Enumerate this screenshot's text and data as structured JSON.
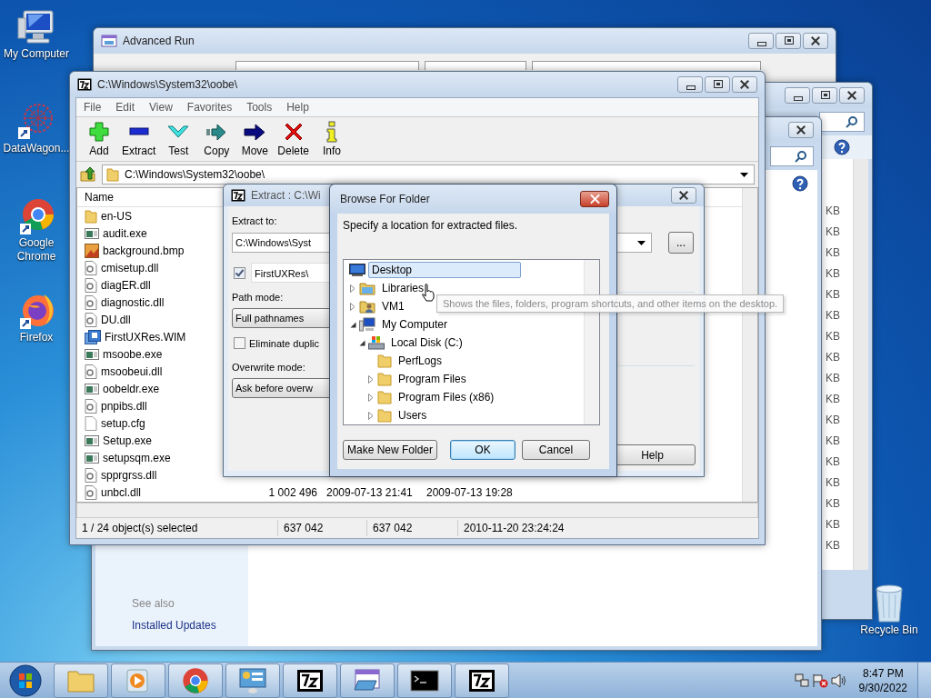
{
  "desktop_icons": [
    {
      "label": "My Computer",
      "kind": "computer"
    },
    {
      "label": "DataWagon...",
      "kind": "datawagon"
    },
    {
      "label": "Google Chrome",
      "kind": "chrome"
    },
    {
      "label": "Firefox",
      "kind": "firefox"
    }
  ],
  "recycle_bin": {
    "label": "Recycle Bin"
  },
  "advanced_run": {
    "title": "Advanced Run"
  },
  "back_window": {
    "units": [
      "KB",
      "KB",
      "KB",
      "KB",
      "KB",
      "KB",
      "KB",
      "KB",
      "KB",
      "KB",
      "KB",
      "KB",
      "KB",
      "KB",
      "KB",
      "KB",
      "KB"
    ]
  },
  "control_window": {
    "heading": "See also",
    "link": "Installed Updates"
  },
  "archive_window": {
    "title": "C:\\Windows\\System32\\oobe\\",
    "menu": [
      "File",
      "Edit",
      "View",
      "Favorites",
      "Tools",
      "Help"
    ],
    "toolbar": [
      {
        "label": "Add",
        "kind": "add"
      },
      {
        "label": "Extract",
        "kind": "extract"
      },
      {
        "label": "Test",
        "kind": "test"
      },
      {
        "label": "Copy",
        "kind": "copy"
      },
      {
        "label": "Move",
        "kind": "move"
      },
      {
        "label": "Delete",
        "kind": "delete"
      },
      {
        "label": "Info",
        "kind": "info"
      }
    ],
    "address": "C:\\Windows\\System32\\oobe\\",
    "columns": [
      "Name"
    ],
    "files": [
      {
        "name": "en-US",
        "kind": "folder"
      },
      {
        "name": "audit.exe",
        "kind": "exe"
      },
      {
        "name": "background.bmp",
        "kind": "image"
      },
      {
        "name": "cmisetup.dll",
        "kind": "dll"
      },
      {
        "name": "diagER.dll",
        "kind": "dll"
      },
      {
        "name": "diagnostic.dll",
        "kind": "dll"
      },
      {
        "name": "DU.dll",
        "kind": "dll"
      },
      {
        "name": "FirstUXRes.WIM",
        "kind": "wim"
      },
      {
        "name": "msoobe.exe",
        "kind": "exe"
      },
      {
        "name": "msoobeui.dll",
        "kind": "dll"
      },
      {
        "name": "oobeldr.exe",
        "kind": "exe"
      },
      {
        "name": "pnpibs.dll",
        "kind": "dll"
      },
      {
        "name": "setup.cfg",
        "kind": "file"
      },
      {
        "name": "Setup.exe",
        "kind": "exe"
      },
      {
        "name": "setupsqm.exe",
        "kind": "exe"
      },
      {
        "name": "spprgrss.dll",
        "kind": "dll"
      },
      {
        "name": "unbcl.dll",
        "kind": "dll",
        "size": "1 002 496",
        "modified": "2009-07-13 21:41",
        "created": "2009-07-13 19:28"
      }
    ],
    "status": [
      "1 / 24 object(s) selected",
      "637 042",
      "637 042",
      "2010-11-20 23:24:24"
    ]
  },
  "extract_dialog": {
    "title": "Extract : C:\\Wi",
    "extract_to_label": "Extract to:",
    "extract_to": "C:\\Windows\\Syst",
    "browse_button": "...",
    "subfolder_checked": true,
    "subfolder": "FirstUXRes\\",
    "path_mode_label": "Path mode:",
    "path_mode": "Full pathnames",
    "eliminate_checked": false,
    "eliminate_label": "Eliminate duplic",
    "overwrite_label": "Overwrite mode:",
    "overwrite": "Ask before overw",
    "help_button": "Help"
  },
  "browse_dialog": {
    "title": "Browse For Folder",
    "prompt": "Specify a location for extracted files.",
    "tree": [
      {
        "label": "Desktop",
        "kind": "desktop",
        "selected": true,
        "children": [
          {
            "label": "Libraries",
            "kind": "libraries",
            "expanded": false,
            "selected": false
          },
          {
            "label": "VM1",
            "kind": "user",
            "expanded": false,
            "selected": false
          },
          {
            "label": "My Computer",
            "kind": "computer",
            "expanded": true,
            "selected": false,
            "children": [
              {
                "label": "Local Disk (C:)",
                "kind": "disk",
                "expanded": true,
                "selected": false,
                "children": [
                  {
                    "label": "PerfLogs",
                    "kind": "folder",
                    "selected": false
                  },
                  {
                    "label": "Program Files",
                    "kind": "folder",
                    "expanded": false,
                    "selected": false
                  },
                  {
                    "label": "Program Files (x86)",
                    "kind": "folder",
                    "expanded": false,
                    "selected": false
                  },
                  {
                    "label": "Users",
                    "kind": "folder",
                    "expanded": false,
                    "selected": false
                  }
                ]
              }
            ]
          }
        ]
      }
    ],
    "buttons": [
      {
        "label": "Make New Folder",
        "default": false
      },
      {
        "label": "OK",
        "default": true
      },
      {
        "label": "Cancel",
        "default": false
      }
    ]
  },
  "tooltip": "Shows the files, folders, program shortcuts, and other items on the desktop.",
  "taskbar": {
    "items": [
      {
        "kind": "explorer"
      },
      {
        "kind": "media"
      },
      {
        "kind": "chrome"
      },
      {
        "kind": "control"
      },
      {
        "kind": "sevenzip"
      },
      {
        "kind": "advrun"
      },
      {
        "kind": "console"
      },
      {
        "kind": "sevenzip"
      }
    ],
    "time": "8:47 PM",
    "date": "9/30/2022"
  }
}
